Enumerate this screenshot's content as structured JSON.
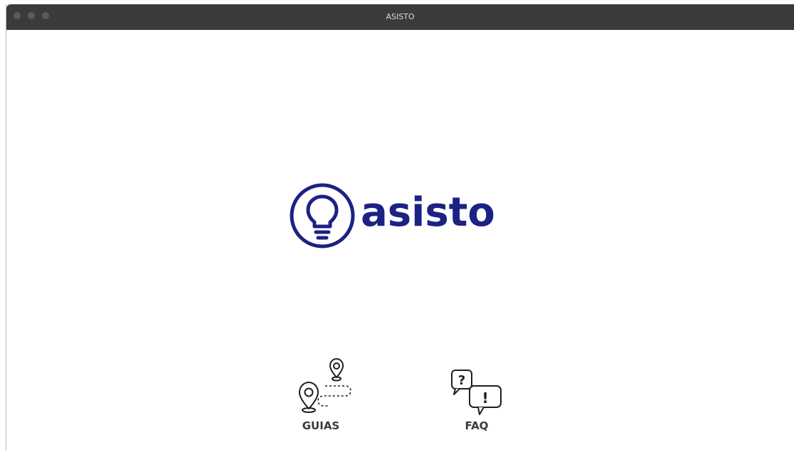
{
  "window": {
    "title": "ASISTO"
  },
  "logo": {
    "wordmark": "asisto",
    "icon": "lightbulb-icon",
    "color": "#1c2284"
  },
  "nav": {
    "guias": {
      "label": "GUIAS",
      "icon": "map-route-pins-icon"
    },
    "faq": {
      "label": "FAQ",
      "icon": "question-exclamation-bubbles-icon"
    }
  }
}
